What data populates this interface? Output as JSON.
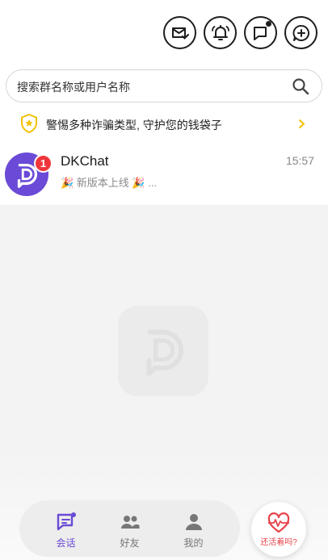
{
  "top_actions": [
    {
      "name": "mail-check-icon"
    },
    {
      "name": "bell-icon"
    },
    {
      "name": "message-icon"
    },
    {
      "name": "add-chat-icon"
    }
  ],
  "search": {
    "placeholder": "搜索群名称或用户名称"
  },
  "notice": {
    "text": "警惕多种诈骗类型, 守护您的钱袋子"
  },
  "conversations": [
    {
      "name": "DKChat",
      "time": "15:57",
      "preview": "🎉 新版本上线 🎉 ...",
      "unread": "1"
    }
  ],
  "tabs": [
    {
      "label": "会话",
      "active": true
    },
    {
      "label": "好友",
      "active": false
    },
    {
      "label": "我的",
      "active": false
    }
  ],
  "alive_button": {
    "label": "还活着吗?"
  },
  "colors": {
    "accent": "#6a4ad6",
    "badge": "#f0363a",
    "notice_icon": "#f2c100",
    "alive": "#e8434a"
  }
}
